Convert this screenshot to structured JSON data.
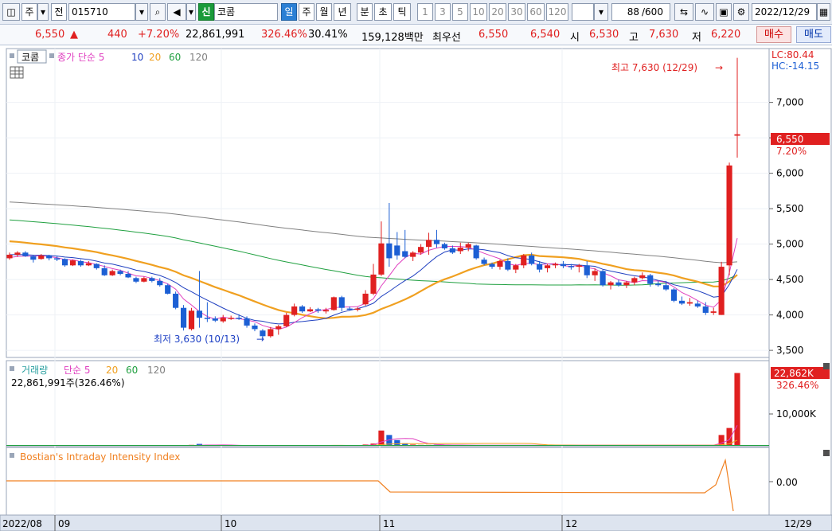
{
  "toolbar": {
    "icon_left": "chart-icon",
    "market": "주",
    "ctrl_jeon": "전",
    "code": "015710",
    "shin_badge": "신",
    "stock_name": "코콤",
    "periods": [
      "일",
      "주",
      "월",
      "년",
      "분",
      "초",
      "틱"
    ],
    "active_period": "일",
    "intervals": [
      "1",
      "3",
      "5",
      "10",
      "20",
      "30",
      "60",
      "120"
    ],
    "count": "88",
    "count_max": "/600",
    "date": "2022/12/29"
  },
  "quote": {
    "price": "6,550",
    "change": "440",
    "change_pct": "+7.20%",
    "volume": "22,861,991",
    "volume_ratio": "326.46%",
    "turnover": "30.41%",
    "amount": "159,128백만",
    "best_label": "최우선",
    "best_ask": "6,550",
    "best_bid": "6,540",
    "open_label": "시",
    "open": "6,530",
    "high_label": "고",
    "high": "7,630",
    "low_label": "저",
    "low": "6,220",
    "buy": "매수",
    "sell": "매도"
  },
  "price_panel": {
    "stock_tag": "코콤",
    "ma_label": "종가 단순 5",
    "ma": [
      "10",
      "20",
      "60",
      "120"
    ],
    "lc": "LC:80.44",
    "hc": "HC:-14.15",
    "high_note": "최고 7,630 (12/29)",
    "low_note": "최저 3,630 (10/13)",
    "current_price": "6,550",
    "current_pct": "7.20%",
    "y_ticks": [
      "7,000",
      "6,500",
      "6,000",
      "5,500",
      "5,000",
      "4,500",
      "4,000",
      "3,500"
    ]
  },
  "volume_panel": {
    "title": "거래량",
    "ma_label": "단순 5",
    "ma": [
      "20",
      "60",
      "120"
    ],
    "info": "22,861,991주(326.46%)",
    "current": "22,862K",
    "current_pct": "326.46%",
    "y_tick": "10,000K"
  },
  "indicator_panel": {
    "title": "Bostian's Intraday Intensity Index",
    "y_tick": "0.00"
  },
  "x_axis": {
    "labels": [
      "2022/08",
      "09",
      "10",
      "11",
      "12"
    ],
    "end_date": "12/29"
  },
  "colors": {
    "up": "#e02020",
    "down": "#1c5fd4",
    "ma5": "#e040c0",
    "ma10": "#2040c0",
    "ma20": "#f0a020",
    "ma60": "#20a040",
    "ma120": "#808080",
    "iii": "#f08020"
  },
  "chart_data": {
    "type": "candlestick",
    "ylim": [
      3400,
      7760
    ],
    "candles": [
      [
        4800,
        4880,
        4780,
        4850
      ],
      [
        4850,
        4900,
        4820,
        4880
      ],
      [
        4880,
        4900,
        4820,
        4830
      ],
      [
        4830,
        4850,
        4740,
        4780
      ],
      [
        4790,
        4860,
        4780,
        4840
      ],
      [
        4840,
        4850,
        4770,
        4800
      ],
      [
        4800,
        4830,
        4760,
        4790
      ],
      [
        4790,
        4800,
        4680,
        4700
      ],
      [
        4700,
        4780,
        4690,
        4770
      ],
      [
        4760,
        4780,
        4680,
        4700
      ],
      [
        4700,
        4760,
        4690,
        4730
      ],
      [
        4720,
        4730,
        4640,
        4660
      ],
      [
        4660,
        4700,
        4550,
        4560
      ],
      [
        4560,
        4640,
        4550,
        4620
      ],
      [
        4620,
        4640,
        4560,
        4580
      ],
      [
        4580,
        4620,
        4520,
        4530
      ],
      [
        4520,
        4540,
        4450,
        4470
      ],
      [
        4470,
        4540,
        4460,
        4520
      ],
      [
        4520,
        4540,
        4460,
        4480
      ],
      [
        4480,
        4520,
        4400,
        4420
      ],
      [
        4420,
        4440,
        4290,
        4300
      ],
      [
        4300,
        4330,
        4080,
        4100
      ],
      [
        4100,
        4140,
        3780,
        3820
      ],
      [
        3800,
        4100,
        3780,
        4060
      ],
      [
        4060,
        4620,
        3820,
        3960
      ],
      [
        3960,
        4180,
        3900,
        3950
      ],
      [
        3950,
        3980,
        3900,
        3920
      ],
      [
        3910,
        4000,
        3890,
        3960
      ],
      [
        3950,
        3990,
        3930,
        3960
      ],
      [
        3960,
        4010,
        3930,
        3950
      ],
      [
        3950,
        3980,
        3820,
        3850
      ],
      [
        3850,
        3880,
        3770,
        3800
      ],
      [
        3780,
        3800,
        3640,
        3700
      ],
      [
        3700,
        3830,
        3680,
        3800
      ],
      [
        3800,
        3860,
        3720,
        3840
      ],
      [
        3840,
        4030,
        3830,
        4000
      ],
      [
        4000,
        4160,
        3980,
        4120
      ],
      [
        4120,
        4140,
        4030,
        4050
      ],
      [
        4050,
        4110,
        4040,
        4080
      ],
      [
        4080,
        4100,
        4030,
        4060
      ],
      [
        4050,
        4100,
        4020,
        4070
      ],
      [
        4070,
        4260,
        4060,
        4250
      ],
      [
        4250,
        4270,
        4050,
        4100
      ],
      [
        4090,
        4120,
        4060,
        4080
      ],
      [
        4080,
        4110,
        4050,
        4090
      ],
      [
        4150,
        4350,
        4130,
        4300
      ],
      [
        4300,
        4720,
        4280,
        4570
      ],
      [
        4570,
        5320,
        4550,
        5010
      ],
      [
        5010,
        5580,
        4680,
        4800
      ],
      [
        4980,
        5170,
        4780,
        4840
      ],
      [
        4900,
        5200,
        4800,
        4820
      ],
      [
        4820,
        4900,
        4760,
        4880
      ],
      [
        4880,
        5000,
        4850,
        4960
      ],
      [
        4960,
        5160,
        4850,
        5060
      ],
      [
        5060,
        5200,
        4950,
        5000
      ],
      [
        5000,
        5020,
        4920,
        4940
      ],
      [
        4940,
        4980,
        4860,
        4880
      ],
      [
        4900,
        5020,
        4860,
        4950
      ],
      [
        4950,
        5020,
        4900,
        5000
      ],
      [
        4980,
        4990,
        4780,
        4800
      ],
      [
        4780,
        4810,
        4700,
        4720
      ],
      [
        4720,
        4740,
        4650,
        4680
      ],
      [
        4680,
        4780,
        4640,
        4760
      ],
      [
        4760,
        4800,
        4620,
        4640
      ],
      [
        4640,
        4720,
        4590,
        4700
      ],
      [
        4700,
        4860,
        4660,
        4840
      ],
      [
        4840,
        4880,
        4700,
        4720
      ],
      [
        4720,
        4760,
        4600,
        4640
      ],
      [
        4660,
        4720,
        4600,
        4700
      ],
      [
        4700,
        4740,
        4660,
        4720
      ],
      [
        4720,
        4760,
        4660,
        4690
      ],
      [
        4690,
        4720,
        4640,
        4680
      ],
      [
        4680,
        4720,
        4600,
        4700
      ],
      [
        4700,
        4760,
        4520,
        4560
      ],
      [
        4560,
        4660,
        4480,
        4620
      ],
      [
        4620,
        4640,
        4400,
        4420
      ],
      [
        4420,
        4480,
        4360,
        4460
      ],
      [
        4460,
        4500,
        4400,
        4420
      ],
      [
        4420,
        4480,
        4380,
        4460
      ],
      [
        4460,
        4540,
        4420,
        4520
      ],
      [
        4520,
        4600,
        4500,
        4560
      ],
      [
        4560,
        4580,
        4400,
        4440
      ],
      [
        4440,
        4480,
        4400,
        4420
      ],
      [
        4420,
        4480,
        4340,
        4360
      ],
      [
        4360,
        4380,
        4180,
        4200
      ],
      [
        4200,
        4260,
        4140,
        4160
      ],
      [
        4160,
        4240,
        4130,
        4180
      ],
      [
        4160,
        4200,
        4100,
        4120
      ],
      [
        4120,
        4180,
        4000,
        4030
      ],
      [
        4030,
        4100,
        4000,
        4050
      ],
      [
        4000,
        4750,
        4000,
        4680
      ],
      [
        4700,
        6150,
        4560,
        6110
      ],
      [
        6530,
        7630,
        6220,
        6550
      ]
    ],
    "volumes": [
      0.0,
      0.0,
      0.0,
      0.0,
      0.0,
      0.0,
      0.0,
      0.0,
      0.0,
      0.0,
      0.0,
      0.0,
      0.0,
      0.0,
      0.0,
      0.0,
      0.0,
      0.0,
      0.0,
      0.0,
      0.0,
      0.0,
      0.0,
      0.3,
      0.6,
      0.3,
      0.1,
      0.1,
      0.1,
      0.1,
      0.1,
      0.1,
      0.1,
      0.1,
      0.1,
      0.1,
      0.1,
      0.1,
      0.1,
      0.1,
      0.1,
      0.1,
      0.1,
      0.1,
      0.1,
      0.4,
      0.7,
      4.8,
      3.4,
      1.8,
      0.8,
      0.4,
      0.3,
      0.3,
      0.3,
      0.2,
      0.2,
      0.2,
      0.2,
      0.2,
      0.2,
      0.2,
      0.2,
      0.2,
      0.2,
      0.2,
      0.2,
      0.2,
      0.2,
      0.2,
      0.2,
      0.2,
      0.2,
      0.2,
      0.2,
      0.2,
      0.2,
      0.2,
      0.2,
      0.2,
      0.2,
      0.2,
      0.2,
      0.2,
      0.2,
      0.2,
      0.2,
      0.2,
      0.2,
      0.2,
      3.4,
      5.6,
      22.862
    ]
  }
}
